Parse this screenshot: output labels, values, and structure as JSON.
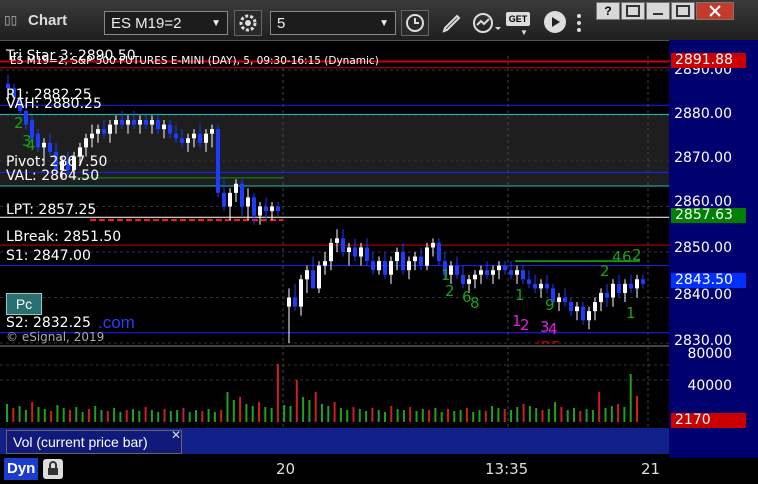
{
  "window": {
    "title": "Chart",
    "symbol": "ES M19=2",
    "interval": "5",
    "get_label": "GET"
  },
  "chart": {
    "header": "ES M19=2, S&P 500 FUTURES E-MINI (DAY), 5, 09:30-16:15 (Dynamic)",
    "levels": {
      "tristar": "Tri Star 3: 2890.50",
      "r1": "R1: 2882.25",
      "vah": "VAH: 2880.25",
      "pivot": "Pivot: 2867.50",
      "val": "VAL: 2864.50",
      "lpt": "LPT: 2857.25",
      "lbreak": "LBreak: 2851.50",
      "s1": "S1: 2847.00",
      "s2": "S2: 2832.25"
    },
    "watermark": "© eSignal, 2019",
    "dotcom": ".com",
    "pc_label": "Pc",
    "price_axis": [
      "2890.00",
      "2880.00",
      "2870.00",
      "2860.00",
      "2850.00",
      "2840.00",
      "2830.00"
    ],
    "price_boxes": {
      "top": "2891.88",
      "lpt": "2857.63",
      "last": "2843.50"
    },
    "volume_axis": [
      "80000",
      "40000"
    ],
    "volume_box": "2170",
    "volume_label": "Vol (current price bar)",
    "x_ticks": [
      "20",
      "13:35",
      "21"
    ],
    "bottom_label": "Dyn",
    "colors": {
      "up_candle": "#ffffff",
      "down_candle": "#1c3cff",
      "accent_red": "#cc0000",
      "accent_green": "#008000"
    }
  }
}
